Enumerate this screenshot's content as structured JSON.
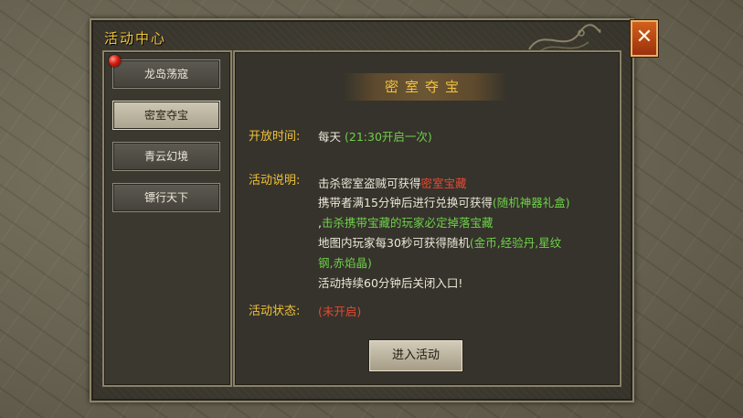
{
  "panel": {
    "title": "活动中心",
    "close_label": "✕"
  },
  "menu": [
    {
      "label": "龙岛荡寇",
      "active": false
    },
    {
      "label": "密室夺宝",
      "active": true
    },
    {
      "label": "青云幻境",
      "active": false
    },
    {
      "label": "镖行天下",
      "active": false
    }
  ],
  "detail": {
    "heading": "密室夺宝",
    "open_time_label": "开放时间:",
    "open_time_value": "每天",
    "open_time_detail": "(21:30开启一次)",
    "desc_label": "活动说明:",
    "desc_line1_a": "击杀密室盗贼可获得",
    "desc_line1_b": "密室宝藏",
    "desc_line2_a": "携带者满15分钟后进行兑换可获得",
    "desc_line2_b": "(随机神器礼盒)",
    "desc_line3_a": ",",
    "desc_line3_b": "击杀携带宝藏的玩家必定掉落宝藏",
    "desc_line4_a": "地图内玩家每30秒可获得随机",
    "desc_line4_b": "(金币,经验丹,星纹",
    "desc_line5": "钢,赤焰晶)",
    "desc_line6": "活动持续60分钟后关闭入口!",
    "status_label": "活动状态:",
    "status_value": "(未开启)",
    "enter_label": "进入活动"
  },
  "colors": {
    "accent_gold": "#f0c13a",
    "green": "#6fd04a",
    "red": "#e34a36"
  }
}
